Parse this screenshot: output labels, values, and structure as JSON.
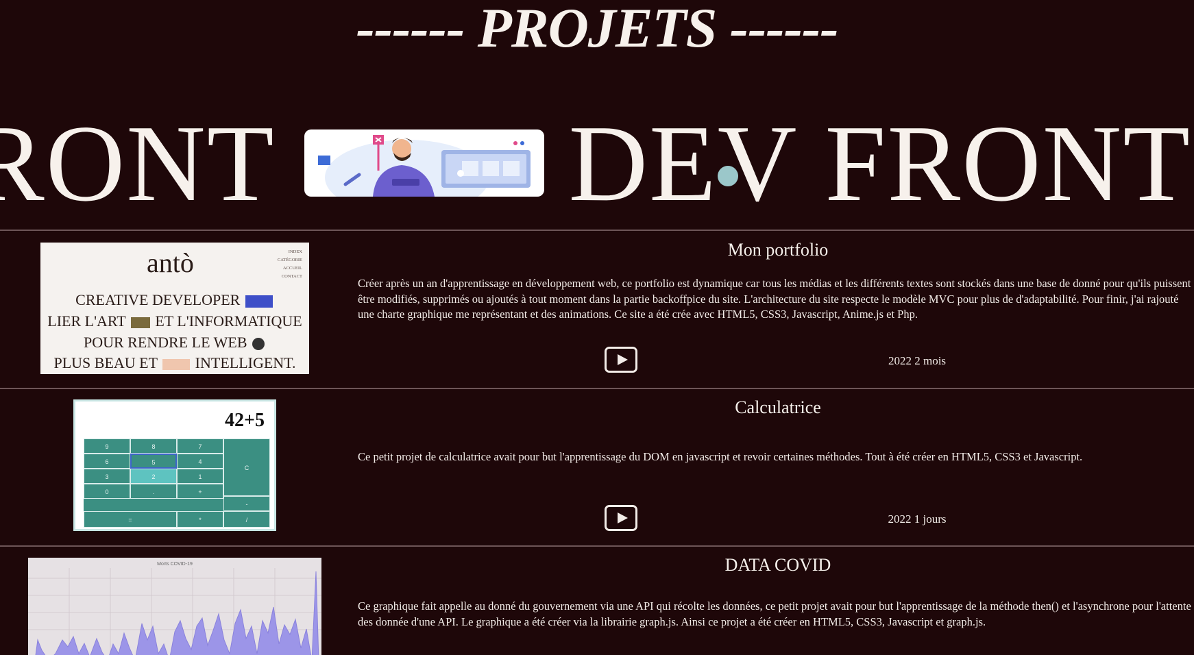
{
  "section": {
    "title": "------ PROJETS ------"
  },
  "marquee": {
    "left_text": "RONT",
    "right_text": "DEV FRONT"
  },
  "projects": [
    {
      "title": "Mon portfolio",
      "description": "Créer après un an d'apprentissage en développement web, ce portfolio est dynamique car tous les médias et les différents textes sont stockés dans une base de donné pour qu'ils puissent être modifiés, supprimés ou ajoutés à tout moment dans la partie backoffpice du site. L'architecture du site respecte le modèle MVC pour plus de d'adaptabilité. Pour finir, j'ai rajouté une charte graphique me représentant et des animations. Ce site a été crée avec HTML5, CSS3, Javascript, Anime.js et Php.",
      "date": "2022 2 mois",
      "thumb": {
        "logo": "antò",
        "menu": [
          "INDEX",
          "CATÉGORIE",
          "ACCUEIL",
          "CONTACT"
        ],
        "lines": [
          "CREATIVE DEVELOPER",
          "LIER L'ART",
          "ET L'INFORMATIQUE",
          "POUR RENDRE LE WEB",
          "PLUS BEAU ET",
          "INTELLIGENT."
        ]
      }
    },
    {
      "title": "Calculatrice",
      "description": "Ce petit projet de calculatrice avait pour but l'apprentissage du DOM en javascript et revoir certaines méthodes. Tout à été créer en HTML5, CSS3 et Javascript.",
      "date": "2022 1 jours",
      "thumb": {
        "display": "42+5",
        "keys": [
          "9",
          "8",
          "7",
          "C",
          "6",
          "5",
          "4",
          "3",
          "2",
          "1",
          "0",
          ".",
          "+",
          "-",
          "=",
          "*",
          "/"
        ]
      }
    },
    {
      "title": "DATA COVID",
      "description": "Ce graphique fait appelle au donné du gouvernement via une API qui récolte les données, ce petit projet avait pour but l'apprentissage de la méthode then() et l'asynchrone pour l'attente des donnée d'une API. Le graphique a été créer via la librairie graph.js. Ainsi ce projet a été créer en HTML5, CSS3, Javascript et graph.js.",
      "thumb": {
        "chart_title": "Morts COVID-19"
      }
    }
  ],
  "icons": {
    "play": "play-icon"
  },
  "colors": {
    "background": "#1e0709",
    "text": "#f3ece8",
    "calc_green": "#3b8f82",
    "covid_fill": "#9c95e8"
  }
}
